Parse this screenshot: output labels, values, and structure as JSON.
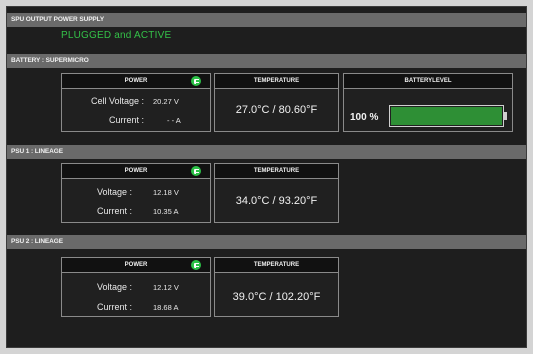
{
  "spu": {
    "header": "SPU OUTPUT POWER SUPPLY",
    "status": "PLUGGED and ACTIVE"
  },
  "battery": {
    "header": "BATTERY : SUPERMICRO",
    "power": {
      "title": "POWER",
      "icon": "power-plug-icon",
      "voltage_label": "Cell Voltage :",
      "voltage_value": "20.27 V",
      "current_label": "Current :",
      "current_value": "- - A"
    },
    "temperature": {
      "title": "TEMPERATURE",
      "value": "27.0°C / 80.60°F"
    },
    "level": {
      "title": "BATTERYLEVEL",
      "percent_text": "100 %",
      "fill_fraction": 1.0
    }
  },
  "psu1": {
    "header": "PSU 1 : LINEAGE",
    "power": {
      "title": "POWER",
      "icon": "power-plug-icon",
      "voltage_label": "Voltage :",
      "voltage_value": "12.18 V",
      "current_label": "Current :",
      "current_value": "10.35 A"
    },
    "temperature": {
      "title": "TEMPERATURE",
      "value": "34.0°C / 93.20°F"
    }
  },
  "psu2": {
    "header": "PSU 2 : LINEAGE",
    "power": {
      "title": "POWER",
      "icon": "power-plug-icon",
      "voltage_label": "Voltage :",
      "voltage_value": "12.12 V",
      "current_label": "Current :",
      "current_value": "18.68 A"
    },
    "temperature": {
      "title": "TEMPERATURE",
      "value": "39.0°C / 102.20°F"
    }
  },
  "colors": {
    "status_green": "#34c048",
    "plug_icon_green": "#2cc147",
    "battery_fill_green": "#2e8f35",
    "section_header_gray": "#6a6a6a",
    "panel_background": "#1e1e1e"
  }
}
